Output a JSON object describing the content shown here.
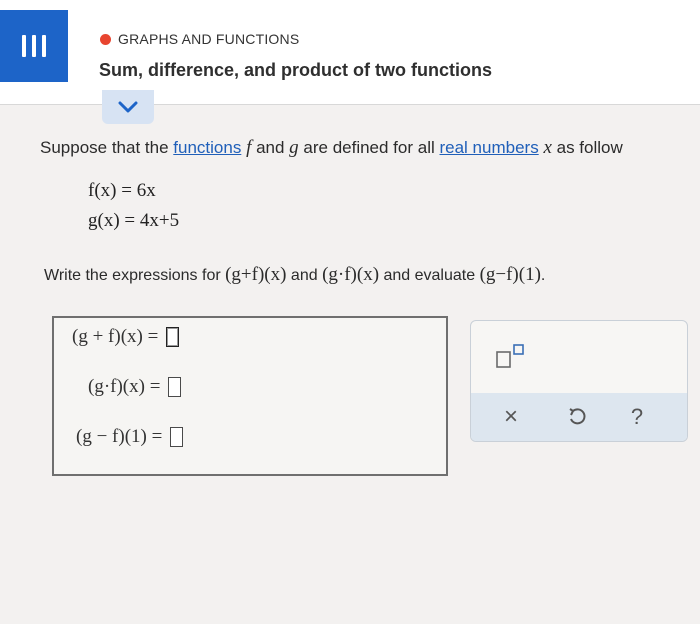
{
  "header": {
    "topic": "GRAPHS AND FUNCTIONS",
    "title": "Sum, difference, and product of two functions",
    "topic_dot_color": "#e8452f",
    "accent_color": "#1d64c8"
  },
  "prompt": {
    "part1": "Suppose that the ",
    "link_functions": "functions",
    "f": " f",
    "part2": " and ",
    "g": "g",
    "part3": " are defined for all ",
    "link_real": "real numbers",
    "x": " x",
    "part4": " as follow"
  },
  "definitions": {
    "f_def": "f(x) = 6x",
    "g_def": "g(x) = 4x+5"
  },
  "instruction": {
    "text1": "Write the expressions for ",
    "expr1": "(g+f)(x)",
    "text2": " and ",
    "expr2": "(g·f)(x)",
    "text3": " and evaluate ",
    "expr3": "(g−f)(1)",
    "text4": "."
  },
  "answers": [
    {
      "label": "(g + f)(x) =",
      "value": ""
    },
    {
      "label": "(g·f)(x) =",
      "value": ""
    },
    {
      "label": "(g − f)(1) =",
      "value": ""
    }
  ],
  "tools": {
    "exponent_icon": "superscript-icon",
    "clear_icon": "×",
    "undo_icon": "undo-icon",
    "help_icon": "?"
  }
}
